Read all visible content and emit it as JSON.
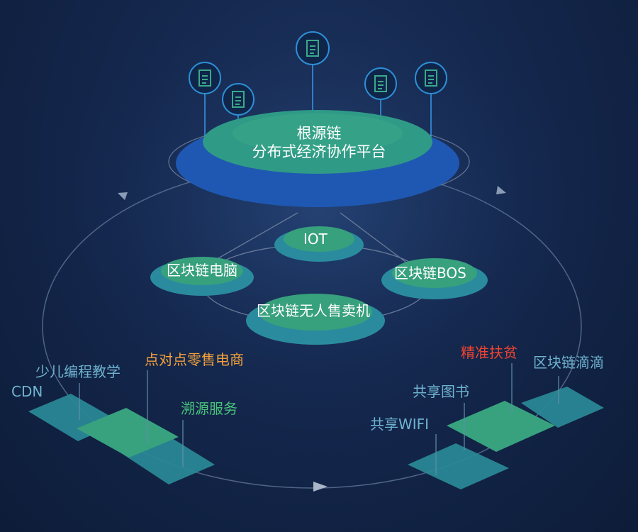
{
  "platform": {
    "line1": "根源链",
    "line2": "分布式经济协作平台"
  },
  "nodes": {
    "iot": "IOT",
    "pc": "区块链电脑",
    "bos": "区块链BOS",
    "vending": "区块链无人售卖机"
  },
  "left_cluster": {
    "cdn": "CDN",
    "coding": "少儿编程教学",
    "p2p": "点对点零售电商",
    "trace": "溯源服务"
  },
  "right_cluster": {
    "poverty": "精准扶贫",
    "didi": "区块链滴滴",
    "books": "共享图书",
    "wifi": "共享WIFI"
  },
  "icons": [
    "document-icon",
    "document-icon",
    "document-icon",
    "document-icon",
    "document-icon"
  ],
  "colors": {
    "background": "#14274d",
    "platform_outer": "#1e56b0",
    "platform_inner": "#2f9a86",
    "node_outer": "#2a8b9f",
    "node_inner": "#37a07d",
    "tile_teal": "#2a8795",
    "tile_green": "#38a27f",
    "label_blue": "#6fb3cf",
    "label_orange": "#f5a23a",
    "label_green": "#49c27a",
    "label_red": "#f0442f"
  }
}
